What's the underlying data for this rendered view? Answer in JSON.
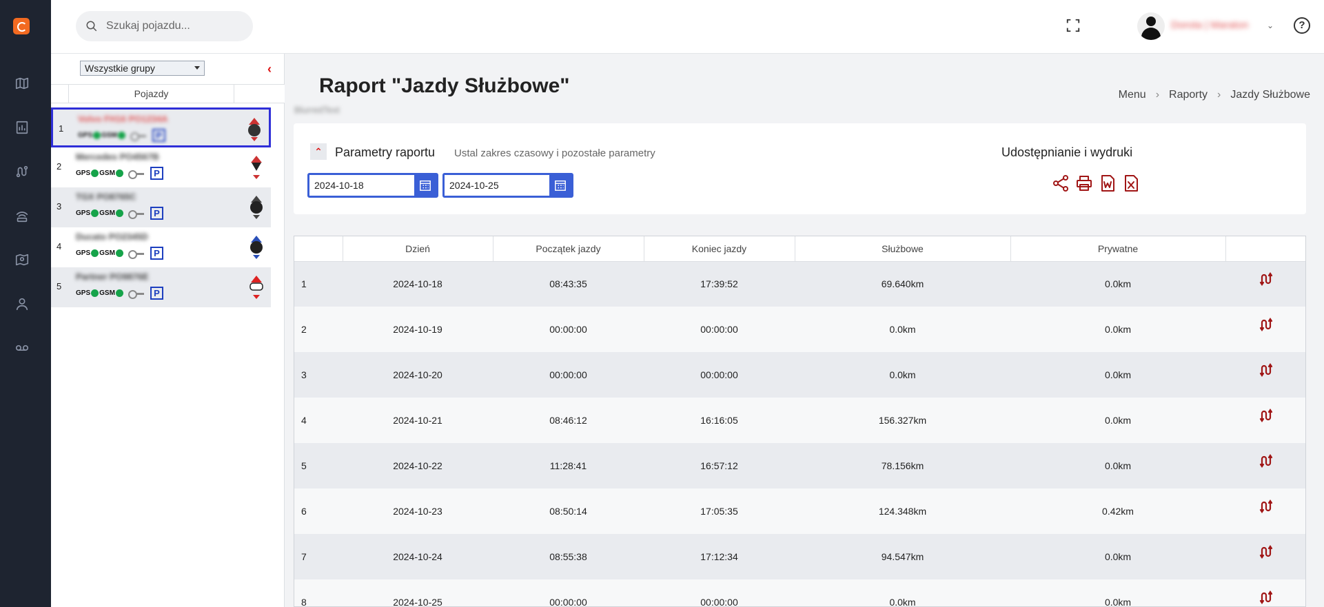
{
  "search": {
    "placeholder": "Szukaj pojazdu..."
  },
  "user": {
    "name": "Dorota | Maraton"
  },
  "vehicles_panel": {
    "group_select": "Wszystkie grupy",
    "column_header": "Pojazdy",
    "status_labels": {
      "gps": "GPS",
      "gsm": "GSM",
      "parking": "P"
    },
    "items": [
      {
        "num": "1",
        "name": "Volvo FH16 PO1234A"
      },
      {
        "num": "2",
        "name": "Mercedes PO4567B"
      },
      {
        "num": "3",
        "name": "TGX PO8765C"
      },
      {
        "num": "4",
        "name": "Ducato PO2345D"
      },
      {
        "num": "5",
        "name": "Partner PO9876E"
      }
    ]
  },
  "page": {
    "title": "Raport \"Jazdy Służbowe\"",
    "subtitle": "BlurredText",
    "breadcrumb": [
      "Menu",
      "Raporty",
      "Jazdy Służbowe"
    ]
  },
  "params": {
    "label": "Parametry raportu",
    "hint": "Ustal zakres czasowy i pozostałe parametry",
    "date_from": "2024-10-18",
    "date_to": "2024-10-25",
    "share_label": "Udostępnianie i wydruki",
    "share_icons": [
      "share-icon",
      "print-icon",
      "word-export-icon",
      "excel-export-icon"
    ]
  },
  "table": {
    "headers": [
      "",
      "Dzień",
      "Początek jazdy",
      "Koniec jazdy",
      "Służbowe",
      "Prywatne",
      ""
    ],
    "rows": [
      [
        "1",
        "2024-10-18",
        "08:43:35",
        "17:39:52",
        "69.640km",
        "0.0km"
      ],
      [
        "2",
        "2024-10-19",
        "00:00:00",
        "00:00:00",
        "0.0km",
        "0.0km"
      ],
      [
        "3",
        "2024-10-20",
        "00:00:00",
        "00:00:00",
        "0.0km",
        "0.0km"
      ],
      [
        "4",
        "2024-10-21",
        "08:46:12",
        "16:16:05",
        "156.327km",
        "0.0km"
      ],
      [
        "5",
        "2024-10-22",
        "11:28:41",
        "16:57:12",
        "78.156km",
        "0.0km"
      ],
      [
        "6",
        "2024-10-23",
        "08:50:14",
        "17:05:35",
        "124.348km",
        "0.42km"
      ],
      [
        "7",
        "2024-10-24",
        "08:55:38",
        "17:12:34",
        "94.547km",
        "0.0km"
      ],
      [
        "8",
        "2024-10-25",
        "00:00:00",
        "00:00:00",
        "0.0km",
        "0.0km"
      ]
    ]
  },
  "colors": {
    "accent": "#3a5fd6",
    "brand": "#f26a21",
    "icon_red": "#a01515",
    "rail": "#1e2430"
  }
}
